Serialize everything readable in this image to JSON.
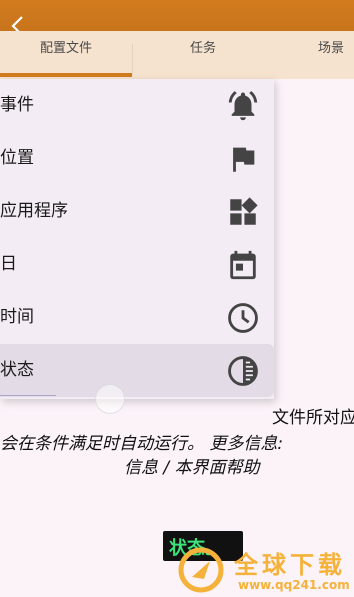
{
  "tabs": [
    {
      "label": "配置文件",
      "selected": true
    },
    {
      "label": "任务",
      "selected": false
    },
    {
      "label": "场景",
      "selected": false
    }
  ],
  "menu": {
    "items": [
      {
        "label": "事件",
        "icon": "bell-icon"
      },
      {
        "label": "位置",
        "icon": "flag-icon"
      },
      {
        "label": "应用程序",
        "icon": "apps-icon"
      },
      {
        "label": "日",
        "icon": "calendar-icon"
      },
      {
        "label": "时间",
        "icon": "clock-icon"
      },
      {
        "label": "状态",
        "icon": "state-icon",
        "selected": true
      }
    ]
  },
  "hint": {
    "line1": "文件所对应",
    "line2": "会在条件满足时自动运行。 更多信息:",
    "line3": "信息 / 本界面帮助"
  },
  "tooltip": {
    "text": "状态。"
  },
  "watermark": {
    "name": "全球下载",
    "url": "www.qq241.com"
  },
  "colors": {
    "accent": "#d27b1f",
    "tab_bg": "#f6e3cf",
    "menu_bg": "#f4ecf4"
  }
}
